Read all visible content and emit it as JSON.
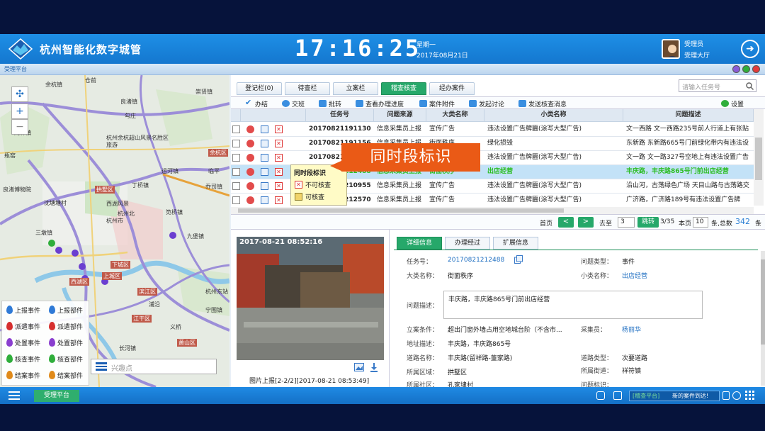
{
  "header": {
    "title": "杭州智能化数字城管",
    "time": "17:16:25",
    "weekday": "星期一",
    "date": "2017年08月21日",
    "user_name": "受理员",
    "user_role": "受理大厅"
  },
  "window": {
    "title": "受理平台"
  },
  "map": {
    "labels": [
      "余杭镇",
      "仓前",
      "良渚镇",
      "勾庄",
      "崇贤镇",
      "闲林镇",
      "杭州余杭超山风景名胜区旅游",
      "余杭区",
      "临平",
      "乔司镇",
      "运河镇",
      "瓶窑",
      "良渚博物院",
      "沈塘塘村",
      "杭州北",
      "丁桥镇",
      "三墩镇",
      "拱墅区",
      "西湖风景",
      "杭州市",
      "笕桥镇",
      "九堡镇",
      "西湖区",
      "上城区",
      "下城区",
      "滨江区",
      "江干区",
      "萧山区",
      "长河镇",
      "浦沿",
      "杭州东站",
      "宁围镇",
      "义桥",
      "西兴"
    ],
    "districts": [
      "余杭区",
      "西湖区",
      "上城区",
      "下城区",
      "江干区",
      "滨江区",
      "萧山区"
    ],
    "legend": [
      "上报事件",
      "上报部件",
      "派遣事件",
      "派遣部件",
      "处置事件",
      "处置部件",
      "核查事件",
      "核查部件",
      "结案事件",
      "结案部件"
    ],
    "legend_colors": [
      "#2f7ad6",
      "#2f7ad6",
      "#d62f2f",
      "#d62f2f",
      "#8a3fcf",
      "#8a3fcf",
      "#2fae3b",
      "#2fae3b",
      "#e08a1a",
      "#e08a1a"
    ],
    "poi_placeholder": "兴趣点"
  },
  "tabs": [
    "登记栏(0)",
    "待查栏",
    "立案栏",
    "稽查核查",
    "经办案件"
  ],
  "active_tab": "稽查核查",
  "search_placeholder": "请输入任务号",
  "toolbar": [
    "办结",
    "交班",
    "批转",
    "查看办理进度",
    "案件附件",
    "发起讨论",
    "发送核查消息"
  ],
  "settings_label": "设置",
  "grid": {
    "columns": [
      "任务号",
      "问题来源",
      "大类名称",
      "小类名称",
      "问题描述"
    ],
    "rows": [
      {
        "id": "20170821191130",
        "source": "信息采集员上报",
        "major": "宣传广告",
        "minor": "违法设置广告牌匾(涂写大型广告)",
        "desc": "文一西路 文一西路235号前人行道上有张贴"
      },
      {
        "id": "20170821191156",
        "source": "信息采集员上报",
        "major": "街面秩序",
        "minor": "绿化损毁",
        "desc": "东新路 东新路665号门前绿化带内有违法设"
      },
      {
        "id": "20170821212225",
        "source": "信息采集员上报",
        "major": "宣传广告",
        "minor": "违法设置广告牌匾(涂写大型广告)",
        "desc": "文一路 文一路327号空地上有违法设置广告"
      },
      {
        "id": "20170821212488",
        "source": "信息采集员上报",
        "major": "街面秩序",
        "minor": "出店经营",
        "desc": "丰庆路，丰庆路865号门前出店经营"
      },
      {
        "id": "20170821210955",
        "source": "信息采集员上报",
        "major": "宣传广告",
        "minor": "违法设置广告牌匾(涂写大型广告)",
        "desc": "沿山河，古荡绿色广场 天目山路与古荡路交"
      },
      {
        "id": "20170821212570",
        "source": "信息采集员上报",
        "major": "宣传广告",
        "minor": "违法设置广告牌匾(涂写大型广告)",
        "desc": "广济路，广济路189号有违法设置广告牌"
      }
    ],
    "selected_row": 3
  },
  "popup": {
    "title": "同时段标识",
    "items": [
      "不可核查",
      "可核查"
    ]
  },
  "callout": "同时段标识",
  "pager": {
    "first": "首页",
    "prev": "<",
    "next": ">",
    "page_label": "去至",
    "page": "3",
    "go": "跳转",
    "total_pages": "3/35",
    "per_page_label": "本页",
    "per_page": "10",
    "suffix": "条,总数",
    "total": "342",
    "unit": "条"
  },
  "photo": {
    "timestamp": "2017-08-21 08:52:16",
    "caption": "图片上报[2-2/2][2017-08-21 08:53:49]"
  },
  "detail": {
    "tabs": [
      "详细信息",
      "办理经过",
      "扩展信息"
    ],
    "fields": {
      "task_no_label": "任务号：",
      "task_no": "20170821212488",
      "problem_type_label": "问题类型：",
      "problem_type": "事件",
      "major_label": "大类名称：",
      "major": "街面秩序",
      "minor_label": "小类名称：",
      "minor": "出店经营",
      "desc_label": "问题描述：",
      "desc": "丰庆路，丰庆路865号门前出店经营",
      "case_cond_label": "立案条件：",
      "case_cond": "超出门窗外墙占用空地城台阶（不含市...",
      "collector_label": "采集员：",
      "collector": "杨丽华",
      "address_label": "地址描述：",
      "address": "丰庆路，丰庆路865号",
      "road_label": "道路名称：",
      "road": "丰庆路(留祥路-董家路)",
      "road_type_label": "道路类型：",
      "road_type": "次要道路",
      "area_label": "所属区域：",
      "area": "拱墅区",
      "street_label": "所属街道：",
      "street": "祥符镇",
      "community_label": "所属社区：",
      "community": "孔家埭村",
      "problem_mark_label": "问题标识："
    }
  },
  "bottom": {
    "taskbar_item": "受理平台",
    "ticker_a": "[稽查平台]",
    "ticker_b": "新的案件到达!"
  }
}
